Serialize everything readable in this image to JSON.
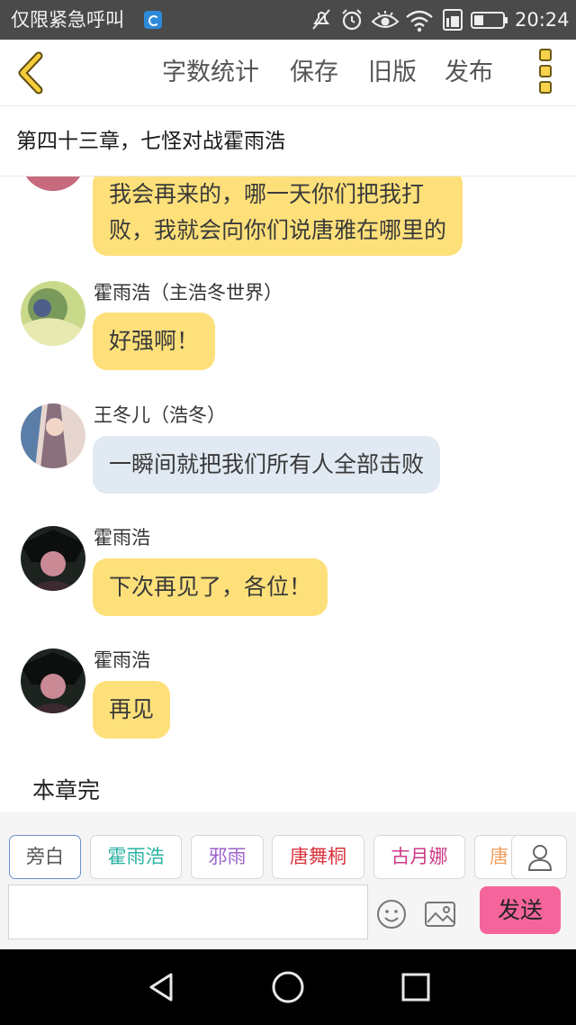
{
  "status_bar": {
    "carrier_text": "仅限紧急呼叫",
    "time": "20:24",
    "icons": [
      "app-notification-icon",
      "mute-icon",
      "alarm-icon",
      "eye-icon",
      "wifi-icon",
      "sim-icon",
      "battery-icon"
    ]
  },
  "toolbar": {
    "back_icon": "chevron-left-icon",
    "word_count_label": "字数统计",
    "save_label": "保存",
    "old_version_label": "旧版",
    "publish_label": "发布",
    "more_icon": "more-vertical-icon"
  },
  "chapter": {
    "title": "第四十三章，七怪对战霍雨浩"
  },
  "messages": [
    {
      "sender": "",
      "text_lines": [
        "我会再来的，哪一天你们把我打",
        "败，我就会向你们说唐雅在哪里的"
      ],
      "color": "yellow"
    },
    {
      "sender": "霍雨浩（主浩冬世界）",
      "text_lines": [
        "好强啊！"
      ],
      "color": "yellow"
    },
    {
      "sender": "王冬儿（浩冬）",
      "text_lines": [
        "一瞬间就把我们所有人全部击败"
      ],
      "color": "blue"
    },
    {
      "sender": "霍雨浩",
      "text_lines": [
        "下次再见了，各位！"
      ],
      "color": "yellow"
    },
    {
      "sender": "霍雨浩",
      "text_lines": [
        "再见"
      ],
      "color": "yellow"
    }
  ],
  "end_note": "本章完",
  "characters": [
    {
      "label": "旁白",
      "color": "#555555",
      "active": true
    },
    {
      "label": "霍雨浩",
      "color": "#2bb3a3",
      "active": false
    },
    {
      "label": "邪雨",
      "color": "#9b63c9",
      "active": false
    },
    {
      "label": "唐舞桐",
      "color": "#d9363e",
      "active": false
    },
    {
      "label": "古月娜",
      "color": "#cc3a86",
      "active": false
    },
    {
      "label": "唐",
      "color": "#f0a060",
      "active": false
    }
  ],
  "composer": {
    "input_value": "",
    "input_placeholder": "",
    "send_label": "发送",
    "emoji_icon": "smiley-icon",
    "image_icon": "image-icon",
    "profile_icon": "person-icon"
  },
  "colors": {
    "bubble_yellow": "#fde07a",
    "bubble_blue": "#e1e9f2",
    "send_button": "#f5659c",
    "accent_yellow": "#f7d24a"
  },
  "nav_bar": {
    "icons": [
      "back-triangle-icon",
      "home-circle-icon",
      "recents-square-icon"
    ]
  }
}
